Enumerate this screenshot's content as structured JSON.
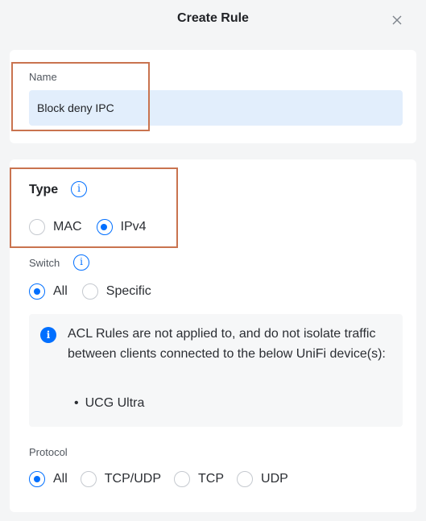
{
  "dialog": {
    "title": "Create Rule",
    "close_icon": "close-icon"
  },
  "name_field": {
    "label": "Name",
    "value": "Block deny IPC"
  },
  "type_section": {
    "title": "Type",
    "info_icon": "info-icon",
    "options": [
      {
        "label": "MAC",
        "checked": false
      },
      {
        "label": "IPv4",
        "checked": true
      }
    ]
  },
  "switch_section": {
    "title": "Switch",
    "info_icon": "info-icon",
    "options": [
      {
        "label": "All",
        "checked": true
      },
      {
        "label": "Specific",
        "checked": false
      }
    ]
  },
  "notice": {
    "icon": "info-filled-icon",
    "text": "ACL Rules are not applied to, and do not isolate traffic between clients connected to the below UniFi device(s):",
    "devices": [
      "UCG Ultra"
    ]
  },
  "protocol_section": {
    "title": "Protocol",
    "options": [
      {
        "label": "All",
        "checked": true
      },
      {
        "label": "TCP/UDP",
        "checked": false
      },
      {
        "label": "TCP",
        "checked": false
      },
      {
        "label": "UDP",
        "checked": false
      }
    ]
  },
  "colors": {
    "accent": "#006fff",
    "highlight_box": "#c9734f",
    "input_bg": "#e2eefc"
  }
}
